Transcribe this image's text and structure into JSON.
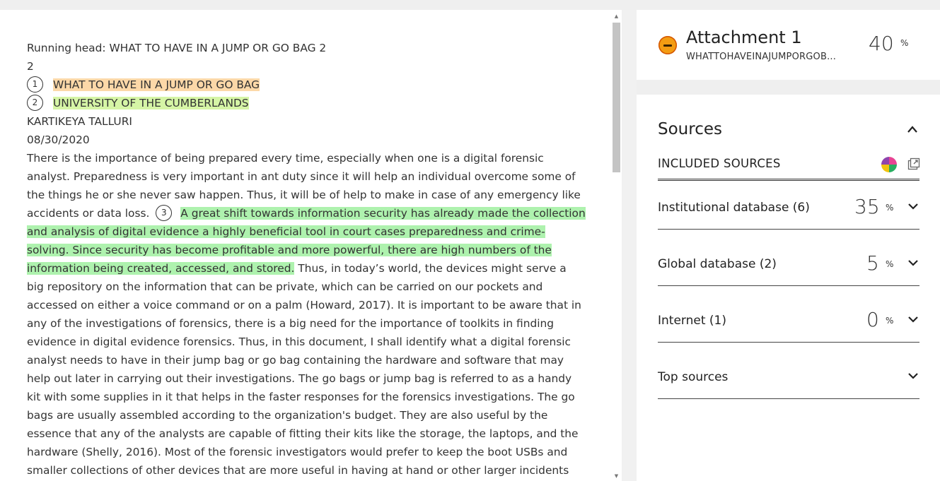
{
  "document": {
    "lines": {
      "running_head": "Running head: WHAT TO HAVE IN A JUMP OR GO BAG 2",
      "page_num": "2",
      "title": "WHAT TO HAVE IN A JUMP OR GO BAG",
      "university": "UNIVERSITY OF THE CUMBERLANDS",
      "author": "KARTIKEYA TALLURI",
      "date": "08/30/2020"
    },
    "match_markers": [
      "1",
      "2",
      "3"
    ],
    "body_intro": "There is the importance of being prepared every time, especially when one is a digital forensic analyst. Preparedness is very important in ant duty since it will help an individual overcome some of the things he or she never saw happen. Thus, it will be of help to make in case of any emergency like accidents or data loss.",
    "body_match": "A great shift towards information security has already made the collection and analysis of digital evidence a highly beneficial tool in court cases preparedness and crime-solving. Since security has become profitable and more powerful, there are high numbers of the information being created, accessed, and stored.",
    "body_rest": " Thus, in today’s world, the devices might serve a big repository on the information that can be private, which can be carried on our pockets and accessed on either a voice command or on a palm (Howard, 2017). It is important to be aware that in any of the investigations of forensics, there is a big need for the importance of toolkits in finding evidence in digital evidence forensics. Thus, in this document, I shall identify what a digital forensic analyst needs to have in their jump bag or go bag containing the hardware and software that may help out later in carrying out their investigations. The go bags or jump bag is referred to as a handy kit with some supplies in it that helps in the faster responses for the forensics investigations. The go bags are usually assembled according to the organization's budget. They are also useful by the essence that any of the analysts are capable of fitting their kits like the storage, the laptops, and the hardware (Shelly, 2016). Most of the forensic investigators would prefer to keep the boot USBs and smaller collections of other devices that are more useful in having at hand or other larger incidents that will be described. The jump bags which are used by the forensic investigators"
  },
  "attachment": {
    "title": "Attachment 1",
    "filename": "WHATTOHAVEINAJUMPORGOB...",
    "percent": "40",
    "percent_symbol": "%"
  },
  "sources": {
    "title": "Sources",
    "included_label": "INCLUDED SOURCES",
    "rows": [
      {
        "label": "Institutional database (6)",
        "percent": "35",
        "symbol": "%"
      },
      {
        "label": "Global database (2)",
        "percent": "5",
        "symbol": "%"
      },
      {
        "label": "Internet (1)",
        "percent": "0",
        "symbol": "%"
      },
      {
        "label": "Top sources",
        "percent": "",
        "symbol": ""
      }
    ]
  },
  "colors": {
    "highlight_1": "#fcd8a8",
    "highlight_2": "#d6f5a6",
    "highlight_3": "#aef2ae",
    "attachment_icon": "#f39c12"
  },
  "icons": {
    "attachment": "minus-circle-icon",
    "collapse": "chevron-up-icon",
    "expand": "chevron-down-icon",
    "filter": "color-wheel-icon",
    "popout": "popout-icon"
  }
}
